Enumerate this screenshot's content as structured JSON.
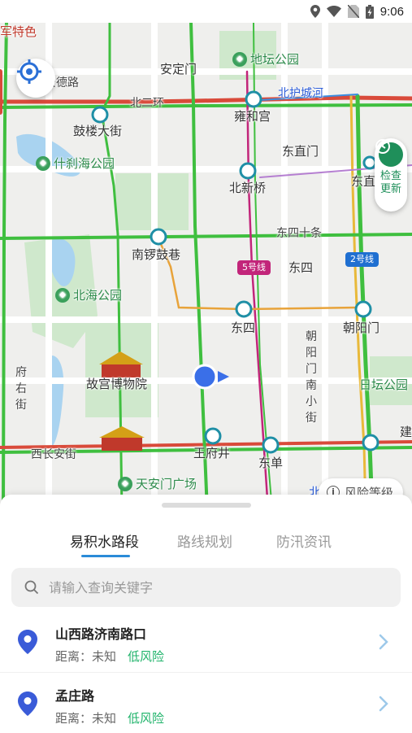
{
  "status_bar": {
    "time": "9:06",
    "icons": [
      "location-icon",
      "wifi-icon",
      "no-sim-icon",
      "battery-charging-icon"
    ]
  },
  "map": {
    "labels": {
      "andingmen": "安定门",
      "ditan": "地坛公园",
      "andelu": "安德路",
      "beierhuan": "北二环",
      "beihuchenghe": "北护城河",
      "yonghegong": "雍和宫",
      "gulou": "鼓楼大街",
      "shichahai": "什刹海公园",
      "dongzhimen": "东直门",
      "beixinqiao": "北新桥",
      "dongzhimen2": "东直门",
      "dongsishitiao": "东四十条",
      "nanluoguxiang": "南锣鼓巷",
      "dongsi": "东四",
      "dongsi2": "东四",
      "chaoyangmen": "朝阳门",
      "beihai": "北海公园",
      "gugong": "故宫博物院",
      "chaoyangmennan": "朝阳门南小街",
      "ritan": "日坛公园",
      "fuyoujie": "府右街",
      "xichangan": "西长安街",
      "wangfujing": "王府井",
      "dongdan": "东单",
      "tiananmen": "天安门广场",
      "beijingzhan": "北京站",
      "jian": "建",
      "junte": "军特色"
    },
    "line5_badge": "5号线",
    "line2_badge": "2号线",
    "check_update_label": "检查更新",
    "risk_level_label": "风险等级"
  },
  "sheet": {
    "tabs": [
      {
        "label": "易积水路段",
        "active": true
      },
      {
        "label": "路线规划",
        "active": false
      },
      {
        "label": "防汛资讯",
        "active": false
      }
    ],
    "search_placeholder": "请输入查询关键字",
    "items": [
      {
        "name": "山西路济南路口",
        "distance": "距离：未知",
        "risk": "低风险"
      },
      {
        "name": "孟庄路",
        "distance": "距离：未知",
        "risk": "低风险"
      }
    ]
  },
  "colors": {
    "accent": "#2a8bd8",
    "low_risk": "#1fb36a",
    "line5": "#c2257a",
    "line2": "#1f6fd1",
    "pin": "#3a5bd8"
  }
}
